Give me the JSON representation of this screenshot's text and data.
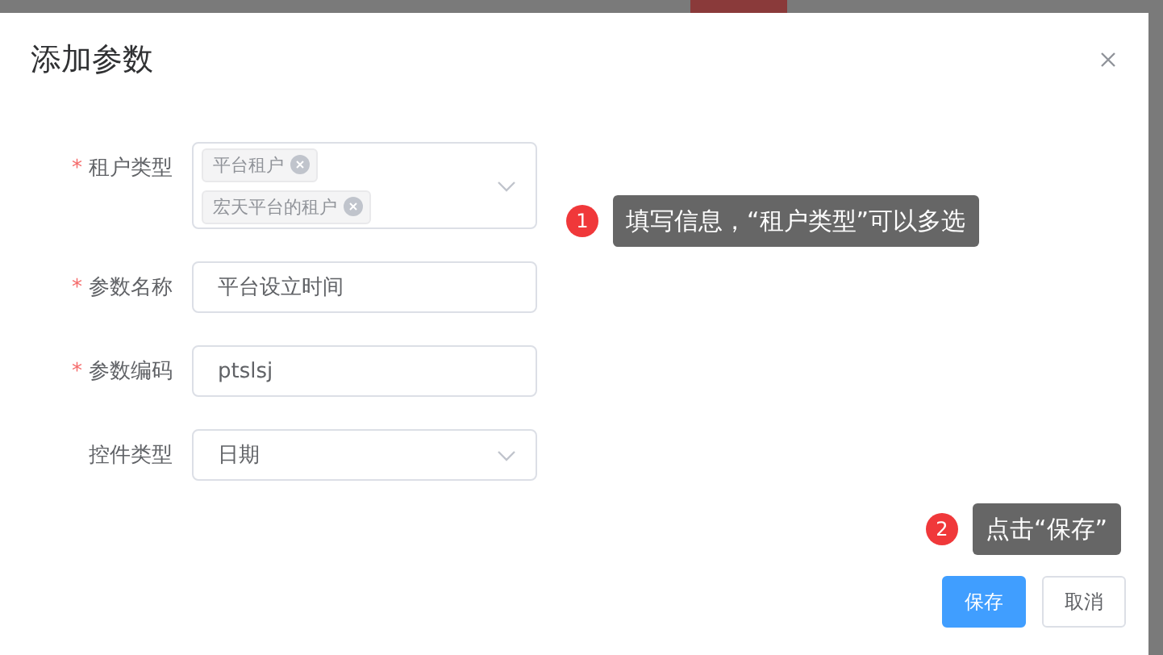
{
  "dialog": {
    "title": "添加参数"
  },
  "form": {
    "fields": [
      {
        "kind": "tags",
        "label": "租户类型",
        "mark": "*",
        "tags": [
          "平台租户",
          "宏天平台的租户"
        ]
      },
      {
        "kind": "text",
        "label": "参数名称",
        "mark": "*",
        "value": "平台设立时间"
      },
      {
        "kind": "text",
        "label": "参数编码",
        "mark": "*",
        "value": "ptslsj"
      },
      {
        "kind": "select",
        "label": "控件类型",
        "value": "日期"
      }
    ]
  },
  "buttons": [
    {
      "label": "保存",
      "kind": "primary"
    },
    {
      "label": "取消",
      "kind": "default"
    }
  ],
  "callouts": [
    {
      "number": "1",
      "text": "填写信息，“租户类型”可以多选"
    },
    {
      "number": "2",
      "text": "点击“保存”"
    }
  ]
}
